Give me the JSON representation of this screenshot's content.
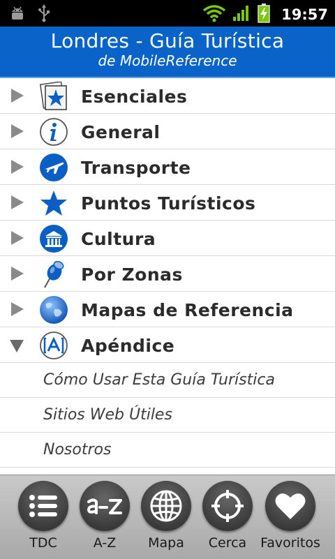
{
  "status_bar": {
    "time": "19:57",
    "icons": [
      "android-debug-icon",
      "usb-icon",
      "wifi-icon",
      "signal-icon",
      "battery-charging-icon"
    ]
  },
  "header": {
    "title": "Londres - Guía Turística",
    "subtitle": "de MobileReference"
  },
  "list": {
    "items": [
      {
        "label": "Esenciales",
        "icon": "star-card-icon",
        "expanded": false
      },
      {
        "label": "General",
        "icon": "info-icon",
        "expanded": false
      },
      {
        "label": "Transporte",
        "icon": "airplane-icon",
        "expanded": false
      },
      {
        "label": "Puntos Turísticos",
        "icon": "star-icon",
        "expanded": false
      },
      {
        "label": "Cultura",
        "icon": "museum-icon",
        "expanded": false
      },
      {
        "label": "Por Zonas",
        "icon": "pushpin-icon",
        "expanded": false
      },
      {
        "label": "Mapas de Referencia",
        "icon": "globe-icon",
        "expanded": false
      },
      {
        "label": "Apéndice",
        "icon": "letter-a-icon",
        "expanded": true
      }
    ],
    "subitems": [
      {
        "label": "Cómo Usar Esta Guía Turística"
      },
      {
        "label": "Sitios Web Útiles"
      },
      {
        "label": "Nosotros"
      }
    ]
  },
  "toolbar": {
    "buttons": [
      {
        "label": "TDC",
        "icon": "list-icon"
      },
      {
        "label": "A-Z",
        "icon": "a-z-icon"
      },
      {
        "label": "Mapa",
        "icon": "globe-icon"
      },
      {
        "label": "Cerca",
        "icon": "crosshair-icon"
      },
      {
        "label": "Favoritos",
        "icon": "heart-icon"
      }
    ]
  },
  "colors": {
    "header_bg": "#0a63c9",
    "accent_blue": "#0a5fc4",
    "status_green": "#7ac70c"
  }
}
